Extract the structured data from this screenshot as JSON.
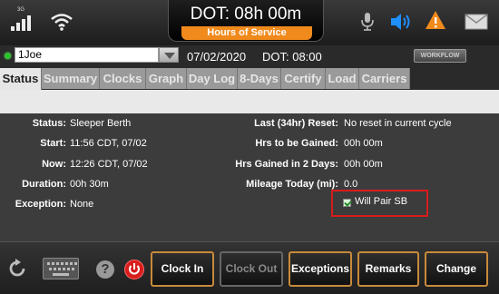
{
  "topbar": {
    "network": "3G",
    "title": "DOT: 08h 00m",
    "subtitle": "Hours of Service",
    "colors": {
      "accent": "#f08a1c",
      "info": "#1e90ff"
    },
    "icons": [
      "signal-icon",
      "wifi-icon",
      "microphone-icon",
      "speaker-icon",
      "warning-icon",
      "mail-icon"
    ]
  },
  "driver_bar": {
    "selected_driver": "1Joe",
    "date": "07/02/2020",
    "dot_time": "DOT: 08:00",
    "workflow_label": "WORKFLOW"
  },
  "tabs": [
    {
      "label": "Status",
      "active": true
    },
    {
      "label": "Summary"
    },
    {
      "label": "Clocks"
    },
    {
      "label": "Graph"
    },
    {
      "label": "Day Log"
    },
    {
      "label": "8-Days"
    },
    {
      "label": "Certify"
    },
    {
      "label": "Load"
    },
    {
      "label": "Carriers"
    }
  ],
  "status": {
    "left": [
      {
        "label": "Status:",
        "value": "Sleeper Berth"
      },
      {
        "label": "Start:",
        "value": "11:56 CDT, 07/02"
      },
      {
        "label": "Now:",
        "value": "12:26 CDT, 07/02"
      },
      {
        "label": "Duration:",
        "value": "00h 30m"
      },
      {
        "label": "Exception:",
        "value": "None"
      }
    ],
    "right": [
      {
        "label": "Last (34hr) Reset:",
        "value": "No reset in current cycle"
      },
      {
        "label": "Hrs to be Gained:",
        "value": "00h 00m"
      },
      {
        "label": "Hrs Gained in 2 Days:",
        "value": "00h 00m"
      },
      {
        "label": "Mileage Today (mi):",
        "value": "0.0"
      }
    ],
    "will_pair_label": "Will Pair SB",
    "will_pair_checked": true
  },
  "actions": [
    {
      "label": "Clock In",
      "enabled": true
    },
    {
      "label": "Clock Out",
      "enabled": false
    },
    {
      "label": "Exceptions",
      "enabled": true
    },
    {
      "label": "Remarks",
      "enabled": true
    },
    {
      "label": "Change",
      "enabled": true
    }
  ],
  "help_label": "?"
}
